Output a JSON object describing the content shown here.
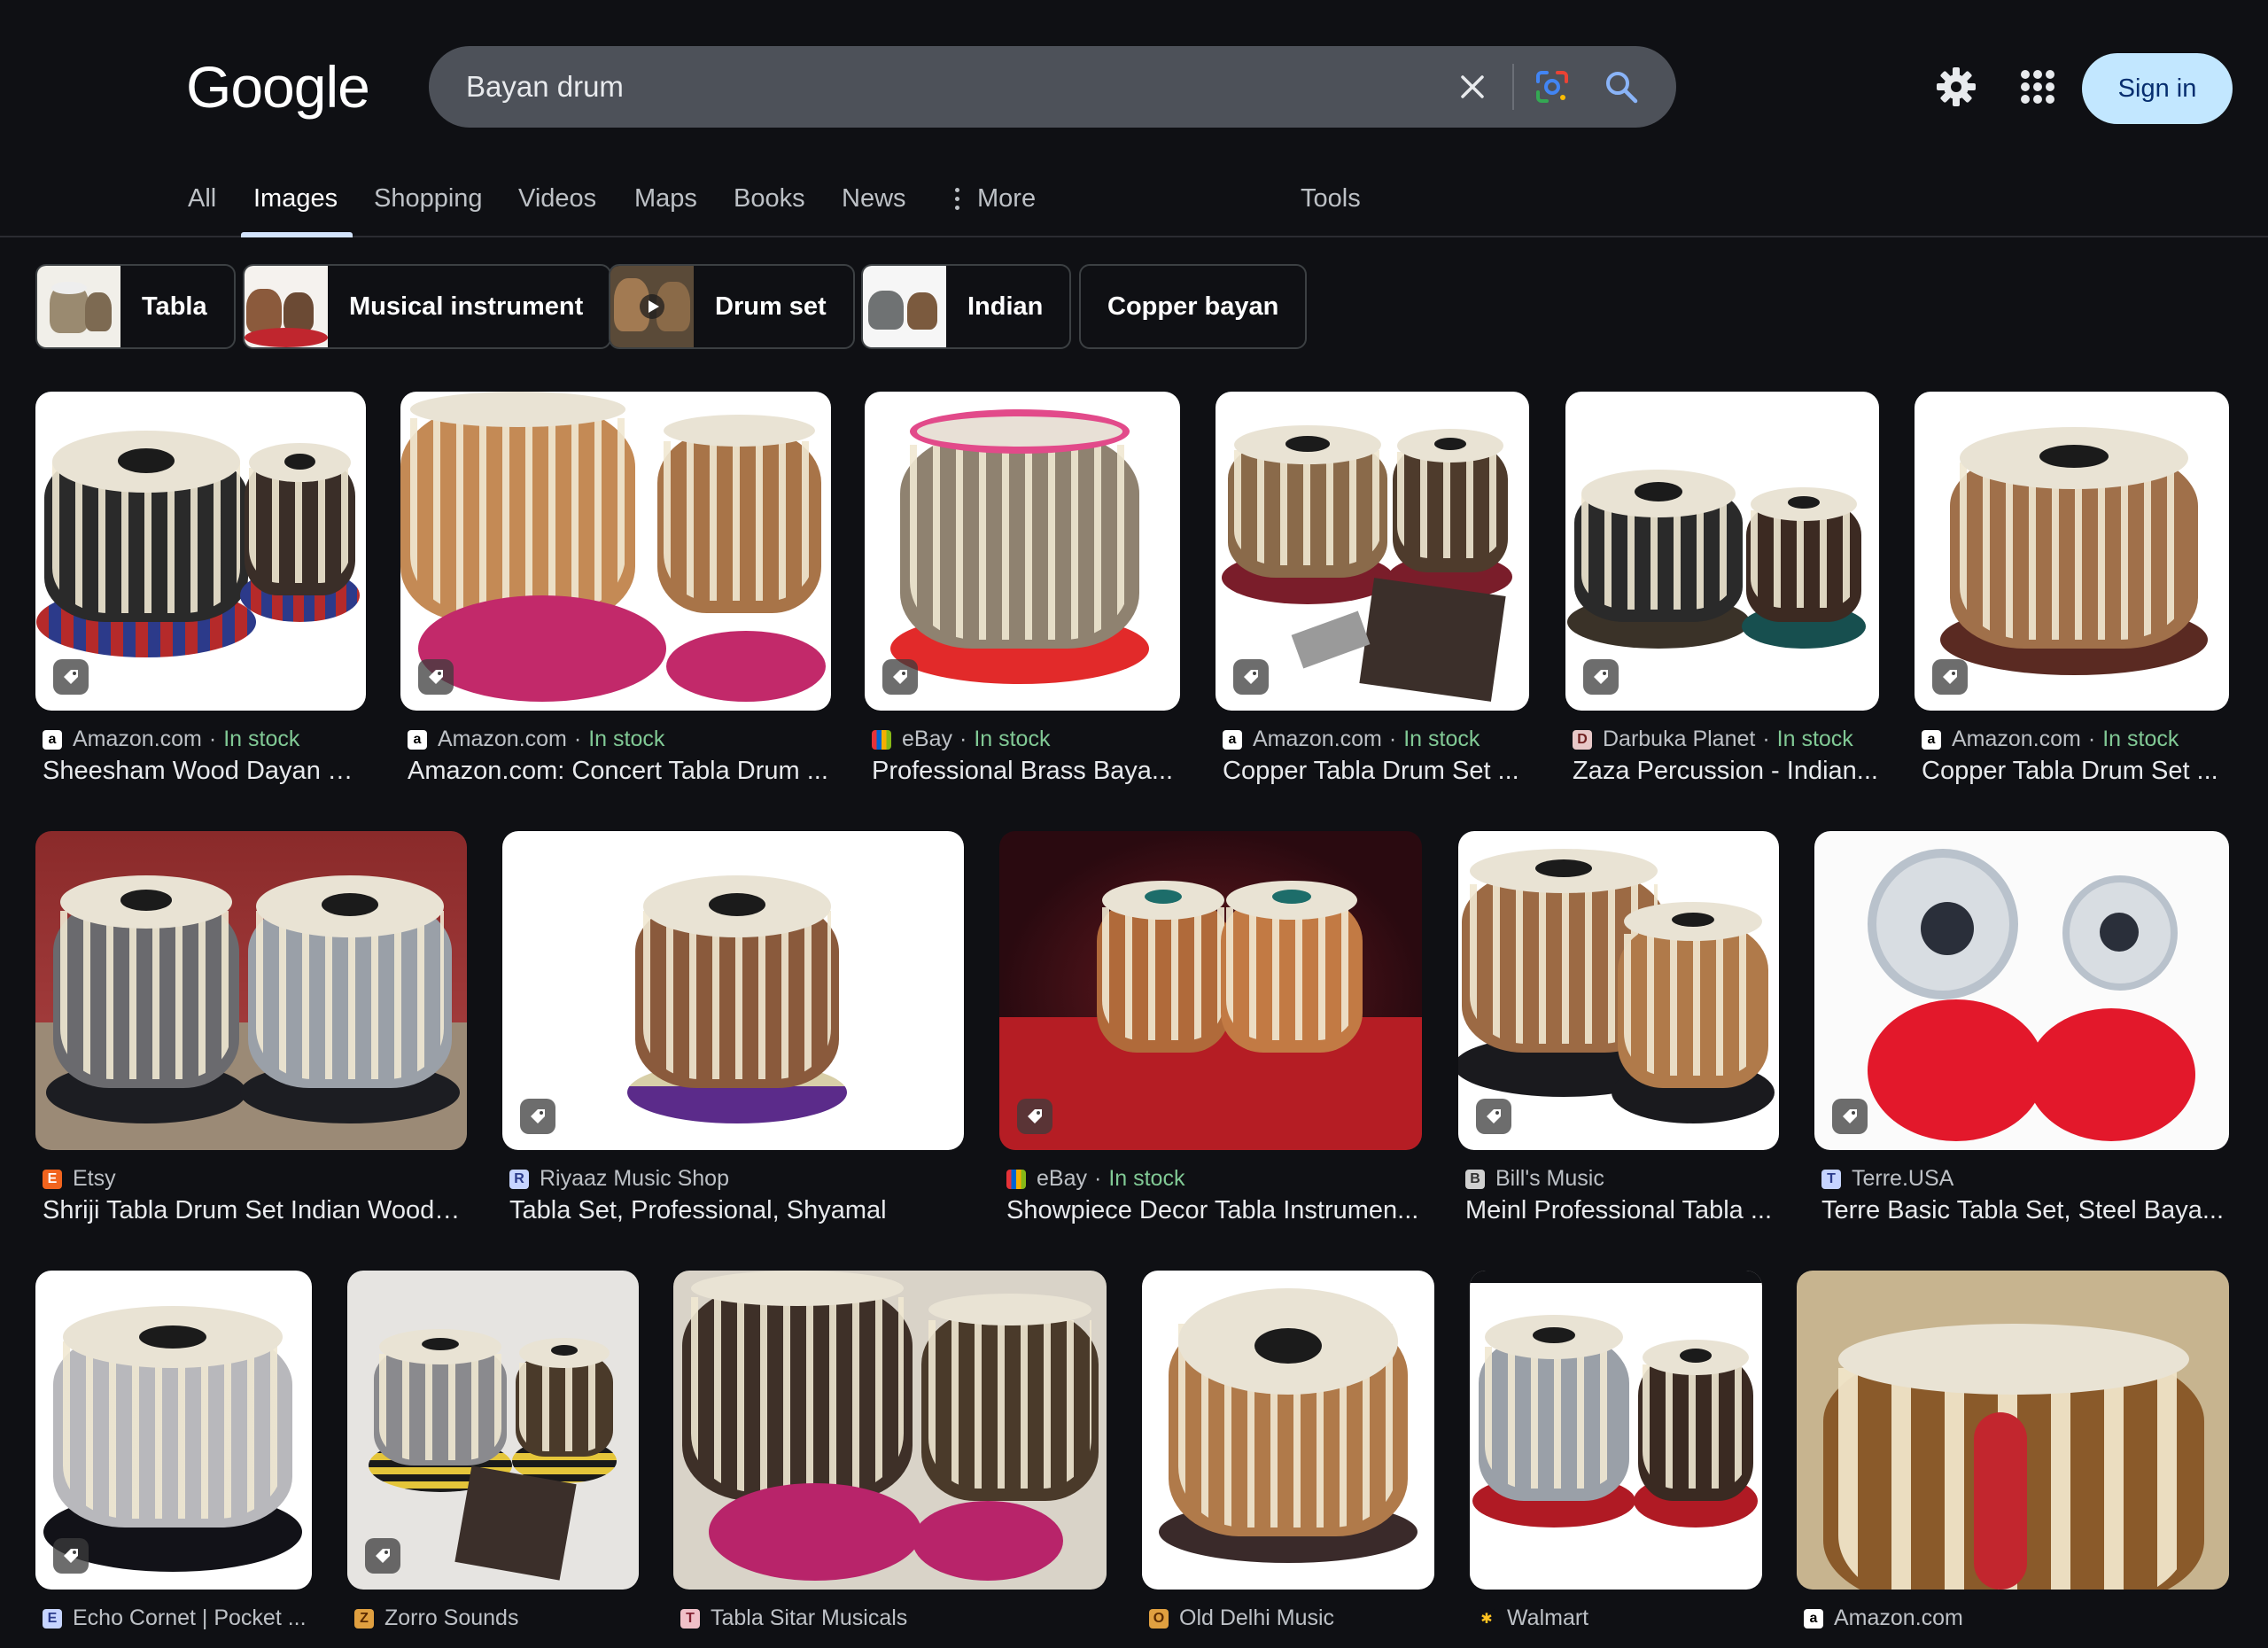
{
  "header": {
    "logo": "Google",
    "search_value": "Bayan drum",
    "sign_in": "Sign in"
  },
  "tabs": [
    "All",
    "Images",
    "Shopping",
    "Videos",
    "Maps",
    "Books",
    "News",
    "More",
    "Tools"
  ],
  "active_tab": "Images",
  "chips": [
    "Tabla",
    "Musical instrument",
    "Drum set",
    "Indian",
    "Copper bayan"
  ],
  "results": [
    {
      "source": "Amazon.com",
      "stock": "In stock",
      "title": "Sheesham Wood Dayan T..."
    },
    {
      "source": "Amazon.com",
      "stock": "In stock",
      "title": "Amazon.com: Concert Tabla Drum ..."
    },
    {
      "source": "eBay",
      "stock": "In stock",
      "title": "Professional Brass Baya..."
    },
    {
      "source": "Amazon.com",
      "stock": "In stock",
      "title": "Copper Tabla Drum Set ..."
    },
    {
      "source": "Darbuka Planet",
      "stock": "In stock",
      "title": "Zaza Percussion - Indian..."
    },
    {
      "source": "Amazon.com",
      "stock": "In stock",
      "title": "Copper Tabla Drum Set ..."
    },
    {
      "source": "Etsy",
      "stock": "",
      "title": "Shriji Tabla Drum Set Indian Woode..."
    },
    {
      "source": "Riyaaz Music Shop",
      "stock": "",
      "title": "Tabla Set, Professional, Shyamal"
    },
    {
      "source": "eBay",
      "stock": "In stock",
      "title": "Showpiece Decor Tabla Instrumen..."
    },
    {
      "source": "Bill's Music",
      "stock": "",
      "title": "Meinl Professional Tabla ..."
    },
    {
      "source": "Terre.USA",
      "stock": "",
      "title": "Terre Basic Tabla Set, Steel Baya..."
    },
    {
      "source": "Echo Cornet | Pocket ...",
      "stock": "",
      "title": ""
    },
    {
      "source": "Zorro Sounds",
      "stock": "",
      "title": ""
    },
    {
      "source": "Tabla Sitar Musicals",
      "stock": "",
      "title": ""
    },
    {
      "source": "Old Delhi Music",
      "stock": "",
      "title": ""
    },
    {
      "source": "Walmart",
      "stock": "",
      "title": ""
    },
    {
      "source": "Amazon.com",
      "stock": "",
      "title": ""
    }
  ],
  "colors": {
    "background": "#0f1014",
    "search_bg": "#4d5159",
    "sign_in_bg": "#c2e7ff",
    "in_stock": "#81c995"
  }
}
